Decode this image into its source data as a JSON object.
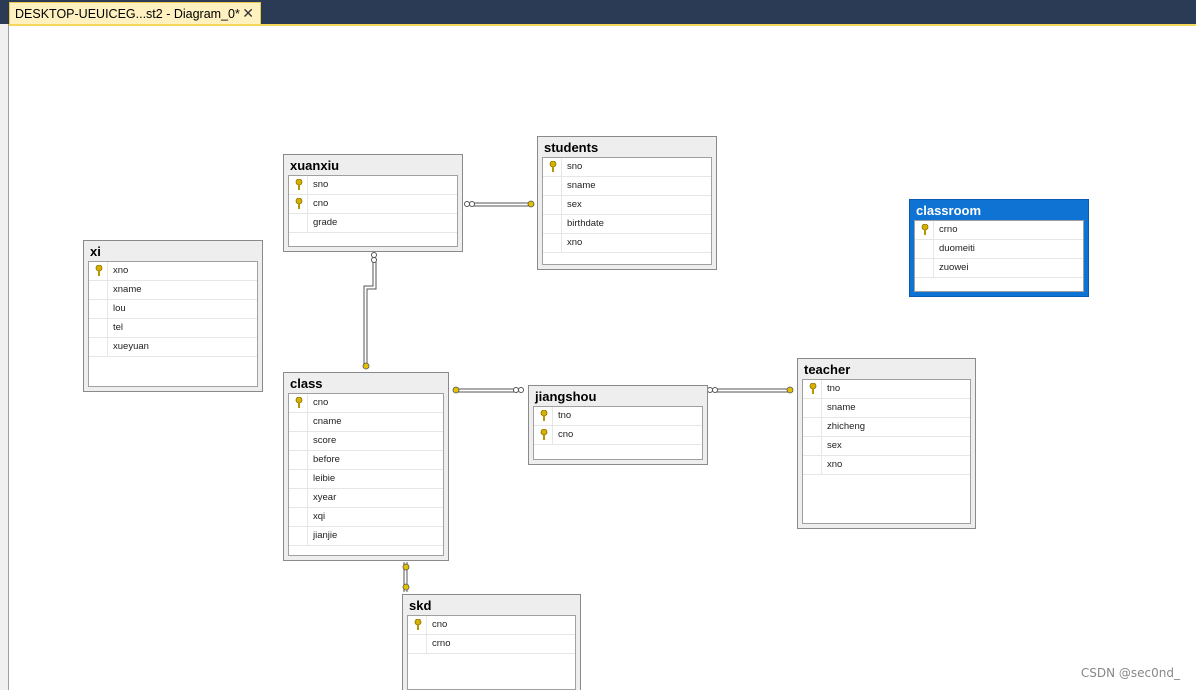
{
  "tab": {
    "title": "DESKTOP-UEUICEG...st2 - Diagram_0*",
    "close_label": "✕"
  },
  "tables": {
    "xuanxiu": {
      "name": "xuanxiu",
      "columns": [
        "sno",
        "cno",
        "grade"
      ]
    },
    "students": {
      "name": "students",
      "columns": [
        "sno",
        "sname",
        "sex",
        "birthdate",
        "xno"
      ]
    },
    "classroom": {
      "name": "classroom",
      "columns": [
        "crno",
        "duomeiti",
        "zuowei"
      ]
    },
    "xi": {
      "name": "xi",
      "columns": [
        "xno",
        "xname",
        "lou",
        "tel",
        "xueyuan"
      ]
    },
    "class": {
      "name": "class",
      "columns": [
        "cno",
        "cname",
        "score",
        "before",
        "leibie",
        "xyear",
        "xqi",
        "jianjie"
      ]
    },
    "jiangshou": {
      "name": "jiangshou",
      "columns": [
        "tno",
        "cno"
      ]
    },
    "teacher": {
      "name": "teacher",
      "columns": [
        "tno",
        "sname",
        "zhicheng",
        "sex",
        "xno"
      ]
    },
    "skd": {
      "name": "skd",
      "columns": [
        "cno",
        "crno"
      ]
    }
  },
  "watermark": "CSDN @sec0nd_",
  "colors": {
    "selected": "#0f73d4",
    "key": "#c8a000",
    "tab": "#fff2c0"
  },
  "icons": {
    "key": "key-icon",
    "close": "close-icon"
  }
}
